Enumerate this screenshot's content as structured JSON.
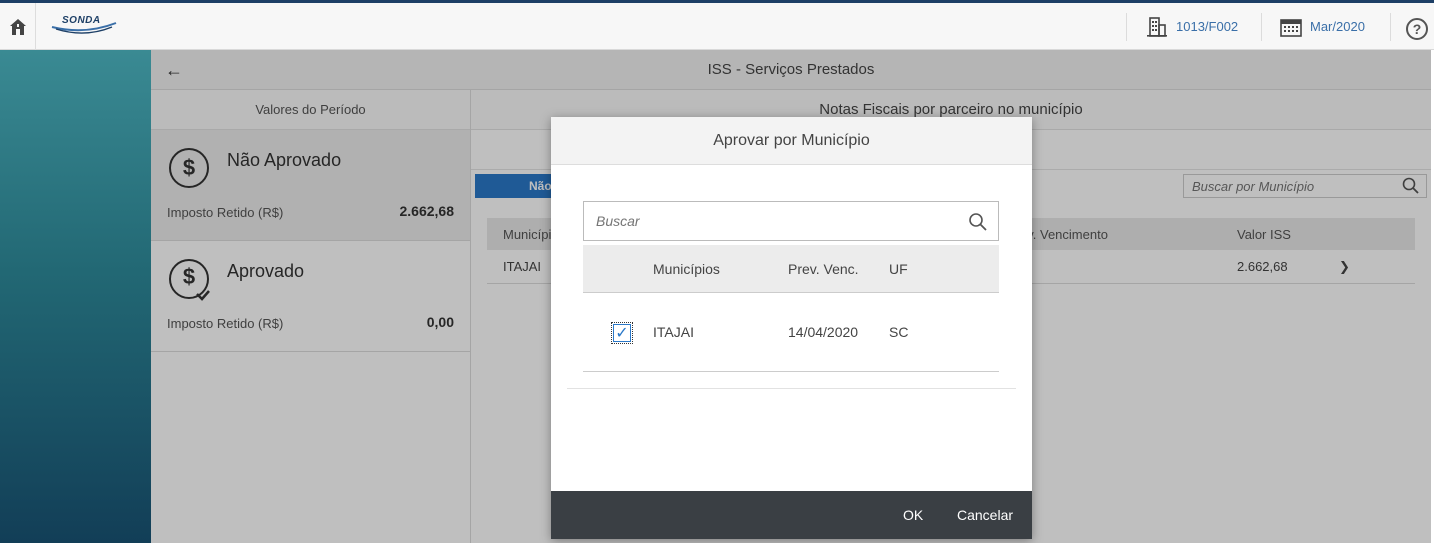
{
  "topbar": {
    "logo_text": "SONDA",
    "company": "1013/F002",
    "period": "Mar/2020",
    "help_symbol": "?"
  },
  "page": {
    "title": "ISS - Serviços Prestados",
    "back_symbol": "←"
  },
  "left_panel": {
    "header": "Valores do Período",
    "cards": [
      {
        "title": "Não Aprovado",
        "label": "Imposto Retido (R$)",
        "value": "2.662,68",
        "icon": "dollar-icon"
      },
      {
        "title": "Aprovado",
        "label": "Imposto Retido (R$)",
        "value": "0,00",
        "icon": "dollar-check-icon"
      }
    ]
  },
  "right_panel": {
    "header": "Notas Fiscais por parceiro no município",
    "tab_label": "Não Aprovado",
    "search_placeholder": "Buscar por Município",
    "columns": [
      "Município",
      "Prev. Vencimento",
      "Valor ISS"
    ],
    "rows": [
      {
        "municipio": "ITAJAI",
        "valor": "2.662,68"
      }
    ],
    "row_arrow": "❯"
  },
  "modal": {
    "title": "Aprovar por Município",
    "search_placeholder": "Buscar",
    "columns": {
      "municipios": "Municípios",
      "prev_venc": "Prev. Venc.",
      "uf": "UF"
    },
    "rows": [
      {
        "checked": true,
        "municipio": "ITAJAI",
        "prev_venc": "14/04/2020",
        "uf": "SC"
      }
    ],
    "ok_label": "OK",
    "cancel_label": "Cancelar"
  },
  "colors": {
    "accent": "#2a78c8",
    "topbar_border": "#1d3f66",
    "footer": "#3a3f44"
  }
}
